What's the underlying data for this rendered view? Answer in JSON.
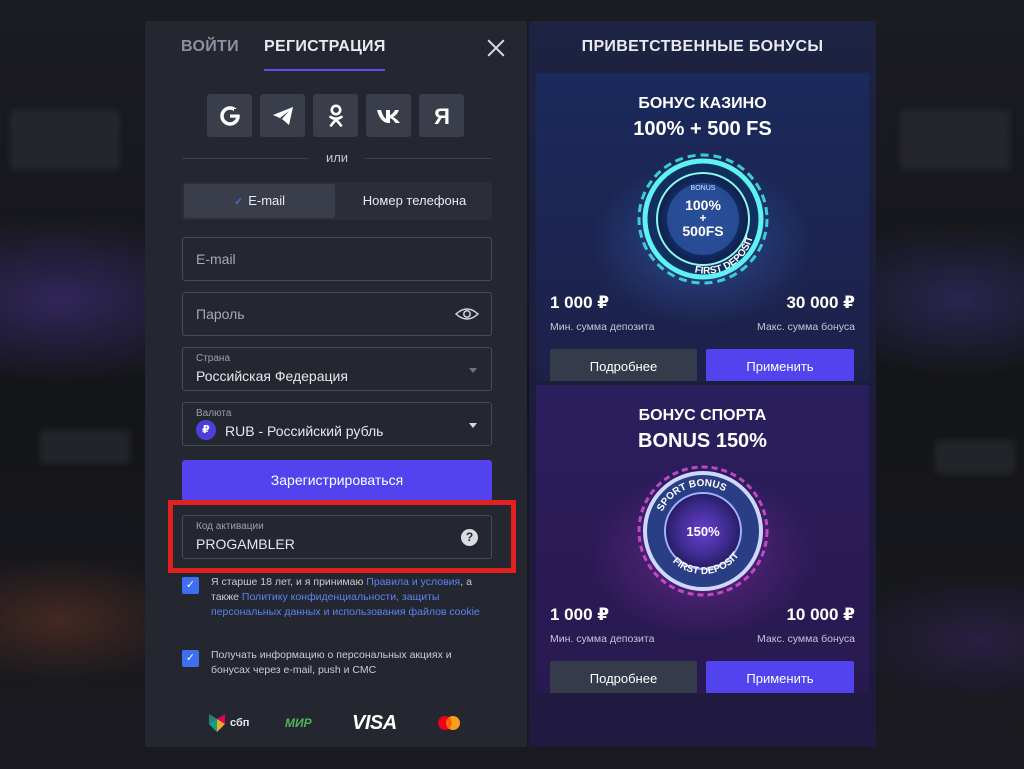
{
  "colors": {
    "accent": "#5243ef",
    "checkbox": "#3d6ff0",
    "link": "#5b83f3",
    "highlight": "#e32020",
    "panel": "#24272f"
  },
  "tabs": {
    "login": "ВОЙТИ",
    "register": "РЕГИСТРАЦИЯ"
  },
  "socials": [
    {
      "icon": "google-icon",
      "glyph": "G"
    },
    {
      "icon": "telegram-icon",
      "glyph": "➤"
    },
    {
      "icon": "odnoklassniki-icon",
      "glyph": "ок"
    },
    {
      "icon": "vk-icon",
      "glyph": "vk"
    },
    {
      "icon": "yandex-icon",
      "glyph": "Я"
    }
  ],
  "or_text": "или",
  "method": {
    "email": "E-mail",
    "phone": "Номер телефона",
    "selected": "email"
  },
  "form": {
    "email_placeholder": "E-mail",
    "password_placeholder": "Пароль",
    "country_label": "Страна",
    "country_value": "Российская Федерация",
    "currency_label": "Валюта",
    "currency_symbol": "₽",
    "currency_value": "RUB - Российский рубль",
    "register_button": "Зарегистрироваться",
    "promo_label": "Код активации",
    "promo_value": "PROGAMBLER",
    "promo_help": "?"
  },
  "consents": {
    "age_text": "Я старше 18 лет, и я принимаю ",
    "age_link1": "Правила и условия",
    "age_mid": ", а также ",
    "age_link2": "Политику конфиденциальности, защиты персональных данных и использования файлов cookie",
    "news_text": "Получать информацию о персональных акциях и бонусах через e-mail, push и СМС"
  },
  "payments": {
    "sbp": "сбп",
    "mir": "МИР",
    "visa": "VISA"
  },
  "bonuses": {
    "title": "ПРИВЕТСТВЕННЫЕ БОНУСЫ",
    "casino": {
      "name": "БОНУС КАЗИНО",
      "value": "100% + 500 FS",
      "badge_top": "BONUS",
      "badge_line1": "100%",
      "badge_line2": "+",
      "badge_line3": "500FS",
      "badge_ring": "FIRST DEPOSIT",
      "min_amount": "1 000 ₽",
      "min_label": "Мин. сумма депозита",
      "max_amount": "30 000 ₽",
      "max_label": "Макс. сумма бонуса",
      "more_button": "Подробнее",
      "apply_button": "Применить"
    },
    "sport": {
      "name": "БОНУС СПОРТА",
      "value": "BONUS 150%",
      "badge_ring_top": "SPORT BONUS",
      "badge_center": "150%",
      "badge_ring_bottom": "FIRST DEPOSIT",
      "min_amount": "1 000 ₽",
      "min_label": "Мин. сумма депозита",
      "max_amount": "10 000 ₽",
      "max_label": "Макс. сумма бонуса",
      "more_button": "Подробнее",
      "apply_button": "Применить"
    }
  }
}
